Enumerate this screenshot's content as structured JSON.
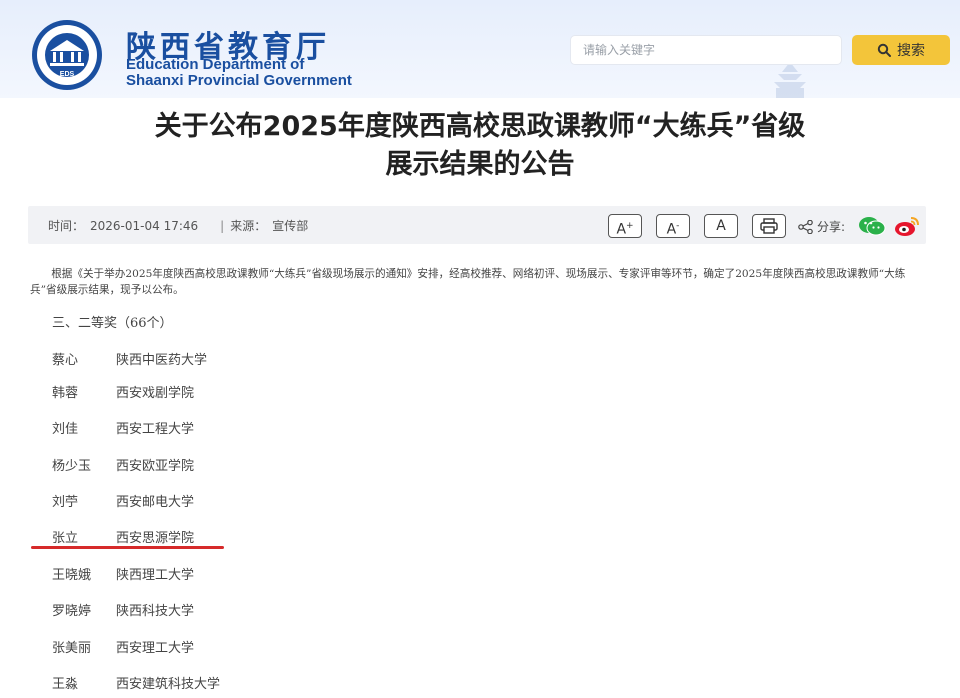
{
  "header": {
    "brand_cn": "陕西省教育厅",
    "brand_en_line1": "Education Department of",
    "brand_en_line2": "Shaanxi Provincial Government",
    "logo_text": "EDS",
    "search_placeholder": "请输入关键字",
    "search_button": "搜索"
  },
  "article": {
    "title_line1": "关于公布2025年度陕西高校思政课教师“大练兵”省级",
    "title_line2": "展示结果的公告",
    "time_label": "时间：",
    "time_value": "2026-01-04 17:46",
    "separator": "|",
    "source_label": "来源：",
    "source_value": "宣传部",
    "font_large": "A",
    "font_small": "A",
    "font_normal": "A",
    "share_label": "分享:",
    "intro": "根据《关于举办2025年度陕西高校思政课教师“大练兵”省级现场展示的通知》安排，经高校推荐、网络初评、现场展示、专家评审等环节，确定了2025年度陕西高校思政课教师“大练兵”省级展示结果，现予以公布。",
    "section": "三、二等奖（66个）",
    "winners": [
      {
        "name": "蔡心",
        "school": "陕西中医药大学"
      },
      {
        "name": "韩蓉",
        "school": "西安戏剧学院"
      },
      {
        "name": "刘佳",
        "school": "西安工程大学"
      },
      {
        "name": "杨少玉",
        "school": "西安欧亚学院"
      },
      {
        "name": "刘苧",
        "school": "西安邮电大学"
      },
      {
        "name": "张立",
        "school": "西安思源学院"
      },
      {
        "name": "王晓娥",
        "school": "陕西理工大学"
      },
      {
        "name": "罗晓婷",
        "school": "陕西科技大学"
      },
      {
        "name": "张美丽",
        "school": "西安理工大学"
      },
      {
        "name": "王淼",
        "school": "西安建筑科技大学"
      }
    ]
  },
  "colors": {
    "brand": "#1a4fa0",
    "search_button": "#f3c53a",
    "highlight_underline": "#d62a2a"
  }
}
